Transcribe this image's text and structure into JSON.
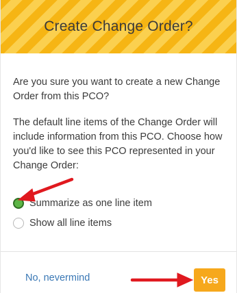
{
  "dialog": {
    "title": "Create Change Order?",
    "question": "Are you sure you want to create a new Change Order from this PCO?",
    "description": "The default line items of the Change Order will include information from this PCO. Choose how you'd like to see this PCO represented in your Change Order:",
    "options": [
      {
        "label": "Summarize as one line item",
        "selected": true
      },
      {
        "label": "Show all line items",
        "selected": false
      }
    ],
    "cancel_label": "No, nevermind",
    "confirm_label": "Yes"
  },
  "colors": {
    "header": "#f8bc1c",
    "accent_button": "#f6a81c",
    "link": "#3a78b5",
    "radio_selected": "#5db546",
    "annotation_arrow": "#e0191f"
  },
  "icons": {
    "annotation_arrows": [
      "red-arrow-icon",
      "red-arrow-icon"
    ]
  }
}
